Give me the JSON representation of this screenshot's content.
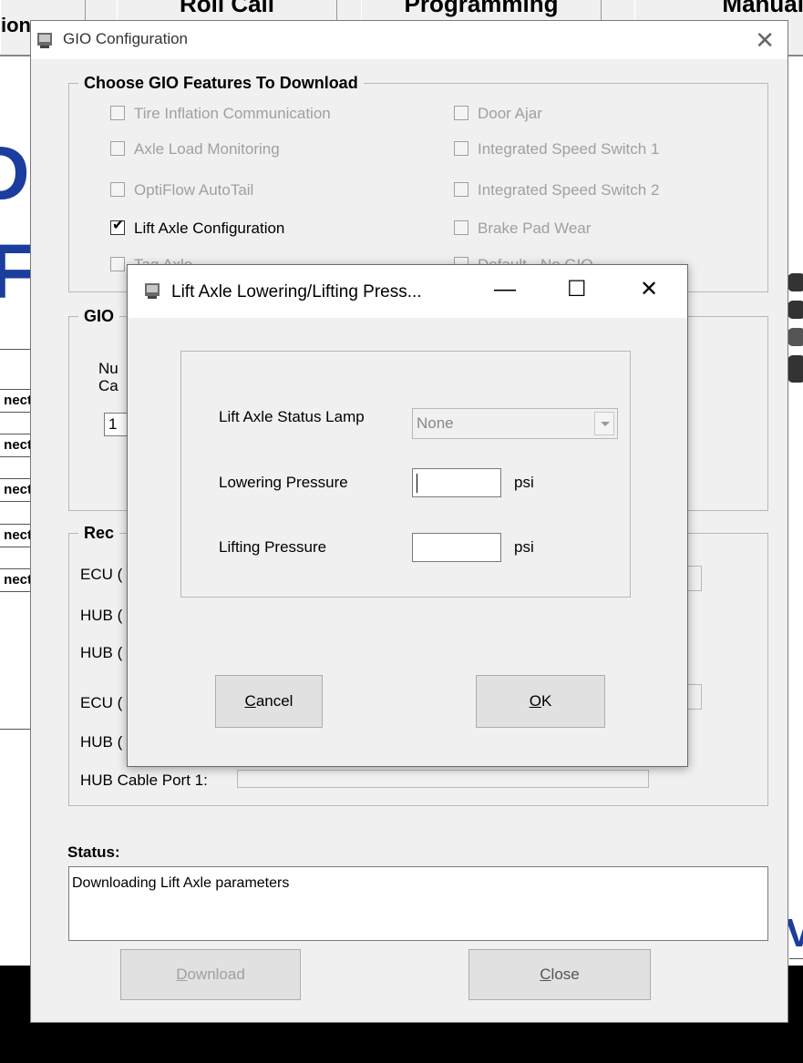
{
  "background_app": {
    "tabs": [
      "ion",
      "Roll Call",
      "Programming",
      "Manual"
    ],
    "letters": [
      "D",
      "F"
    ],
    "connect_buttons": [
      "nect",
      "nect",
      "nect",
      "nect",
      "nect"
    ],
    "right_letter": "V",
    "brand_color": "#1a3d9e"
  },
  "gio_window": {
    "title": "GIO Configuration",
    "icon": "app-icon",
    "features_group": {
      "label": "Choose GIO Features To Download",
      "checkboxes": [
        {
          "label": "Tire Inflation Communication",
          "checked": false,
          "enabled": false
        },
        {
          "label": "Axle Load Monitoring",
          "checked": false,
          "enabled": false
        },
        {
          "label": "OptiFlow AutoTail",
          "checked": false,
          "enabled": false
        },
        {
          "label": "Lift Axle Configuration",
          "checked": true,
          "enabled": true
        },
        {
          "label": "Tag Axle",
          "checked": false,
          "enabled": false
        },
        {
          "label": "Door Ajar",
          "checked": false,
          "enabled": false
        },
        {
          "label": "Integrated Speed Switch 1",
          "checked": false,
          "enabled": false
        },
        {
          "label": "Integrated Speed Switch 2",
          "checked": false,
          "enabled": false
        },
        {
          "label": "Brake Pad Wear",
          "checked": false,
          "enabled": false
        },
        {
          "label": "Default - No GIO",
          "checked": false,
          "enabled": false
        }
      ]
    },
    "gio_group": {
      "label": "GIO",
      "num_label_1": "Nu",
      "num_label_2": "Ca",
      "value": "1"
    },
    "rec_group": {
      "label": "Rec",
      "rows": [
        "ECU (",
        "HUB (",
        "HUB (",
        "ECU (",
        "HUB ("
      ],
      "last_row_label": "HUB Cable Port 1:"
    },
    "status": {
      "label": "Status:",
      "text": "Downloading Lift Axle parameters"
    },
    "buttons": {
      "download_prefix": "D",
      "download_rest": "ownload",
      "close_prefix": "C",
      "close_rest": "lose"
    }
  },
  "dialog": {
    "title": "Lift Axle Lowering/Lifting Press...",
    "minimize": "—",
    "maximize": "☐",
    "close": "✕",
    "status_lamp_label": "Lift Axle Status Lamp",
    "status_lamp_value": "None",
    "lowering_label": "Lowering Pressure",
    "lowering_value": "",
    "lowering_unit": "psi",
    "lifting_label": "Lifting Pressure",
    "lifting_value": "",
    "lifting_unit": "psi",
    "cancel_prefix": "C",
    "cancel_rest": "ancel",
    "ok_prefix": "O",
    "ok_rest": "K"
  }
}
